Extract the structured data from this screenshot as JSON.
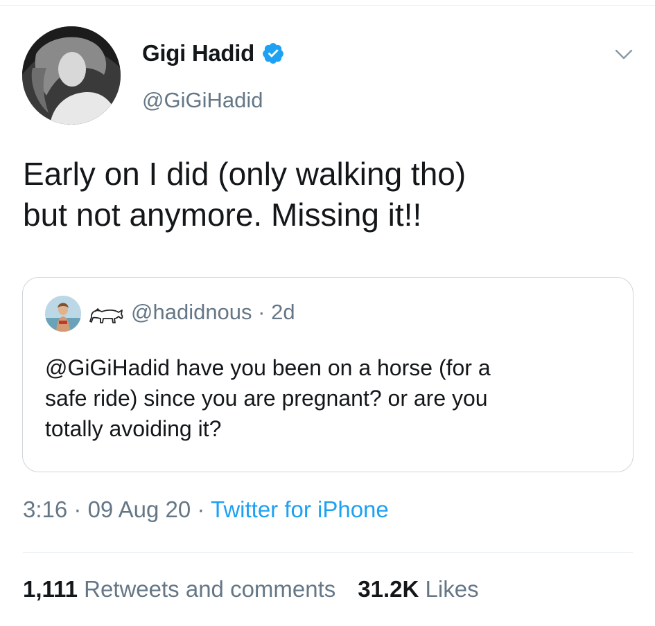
{
  "author": {
    "display_name": "Gigi Hadid",
    "handle": "@GiGiHadid",
    "verified": true,
    "avatar_icon": "profile-photo"
  },
  "tweet": {
    "text_line1": "Early on I did (only walking tho)",
    "text_line2": "but not anymore. Missing it!!"
  },
  "quoted_tweet": {
    "emoji_name": "horse-emoji",
    "handle": "@hadidnous",
    "separator": "·",
    "age": "2d",
    "text_line1": "@GiGiHadid have you been on a horse (for a",
    "text_line2": "safe ride) since you are pregnant? or are you",
    "text_line3": "totally avoiding it?"
  },
  "meta": {
    "time": "3:16",
    "separator": "·",
    "date": "09 Aug 20",
    "source": "Twitter for iPhone"
  },
  "stats": {
    "retweets_count": "1,111",
    "retweets_label": "Retweets and comments",
    "likes_count": "31.2K",
    "likes_label": "Likes"
  },
  "colors": {
    "text": "#14171a",
    "muted": "#657786",
    "accent": "#1da1f2",
    "border": "#ccd6dd"
  }
}
